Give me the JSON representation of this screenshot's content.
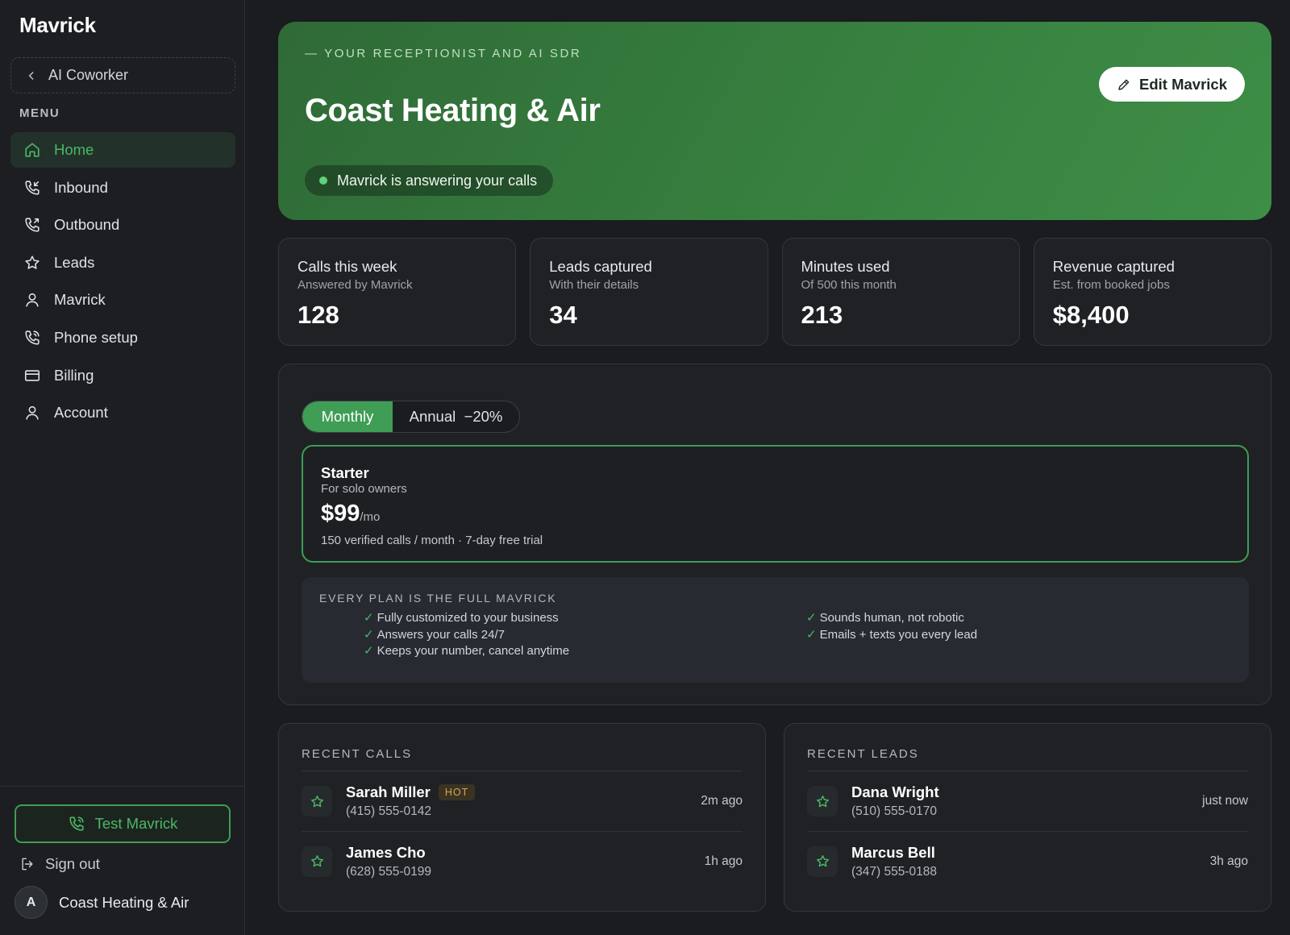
{
  "sidebar": {
    "brand": "Mavrick",
    "back_label": "AI Coworker",
    "menu_label": "MENU",
    "items": [
      {
        "label": "Home",
        "icon": "home-icon"
      },
      {
        "label": "Inbound",
        "icon": "phone-incoming-icon"
      },
      {
        "label": "Outbound",
        "icon": "phone-outgoing-icon"
      },
      {
        "label": "Leads",
        "icon": "star-icon"
      },
      {
        "label": "Mavrick",
        "icon": "user-icon"
      },
      {
        "label": "Phone setup",
        "icon": "phone-icon"
      },
      {
        "label": "Billing",
        "icon": "credit-card-icon"
      },
      {
        "label": "Account",
        "icon": "user-icon"
      }
    ],
    "test_button": "Test Mavrick",
    "sign_out": "Sign out",
    "account_initial": "A",
    "account_name": "Coast Heating & Air"
  },
  "hero": {
    "eyebrow": "— YOUR RECEPTIONIST AND AI SDR",
    "title": "Coast Heating & Air",
    "status": "Mavrick is answering your calls",
    "edit_button": "Edit Mavrick"
  },
  "stats": [
    {
      "title": "Calls this week",
      "sub": "Answered by Mavrick",
      "value": "128"
    },
    {
      "title": "Leads captured",
      "sub": "With their details",
      "value": "34"
    },
    {
      "title": "Minutes used",
      "sub": "Of 500 this month",
      "value": "213"
    },
    {
      "title": "Revenue captured",
      "sub": "Est. from booked jobs",
      "value": "$8,400"
    }
  ],
  "plans": {
    "toggle_monthly": "Monthly",
    "toggle_annual": "Annual  −20%",
    "plan_name": "Starter",
    "plan_desc": "For solo owners",
    "price": "$99",
    "per": "/mo",
    "meta": "150 verified calls / month · 7-day free trial",
    "features_label": "EVERY PLAN IS THE FULL MAVRICK",
    "features_left": [
      "Fully customized to your business",
      "Answers your calls 24/7",
      "Keeps your number, cancel anytime"
    ],
    "features_right": [
      "Sounds human, not robotic",
      "Emails + texts you every lead"
    ]
  },
  "recent_calls": {
    "title": "RECENT CALLS",
    "rows": [
      {
        "name": "Sarah Miller",
        "badge": "HOT",
        "phone": "(415) 555-0142",
        "time": "2m ago"
      },
      {
        "name": "James Cho",
        "phone": "(628) 555-0199",
        "time": "1h ago"
      }
    ]
  },
  "recent_leads": {
    "title": "RECENT LEADS",
    "rows": [
      {
        "name": "Dana Wright",
        "phone": "(510) 555-0170",
        "time": "just now"
      },
      {
        "name": "Marcus Bell",
        "phone": "(347) 555-0188",
        "time": "3h ago"
      }
    ]
  },
  "colors": {
    "accent": "#3f9d55",
    "accent_text": "#4cb864",
    "background": "#1a1c20",
    "hero_green": "#37803f",
    "hot_badge": "#d5a64e"
  }
}
